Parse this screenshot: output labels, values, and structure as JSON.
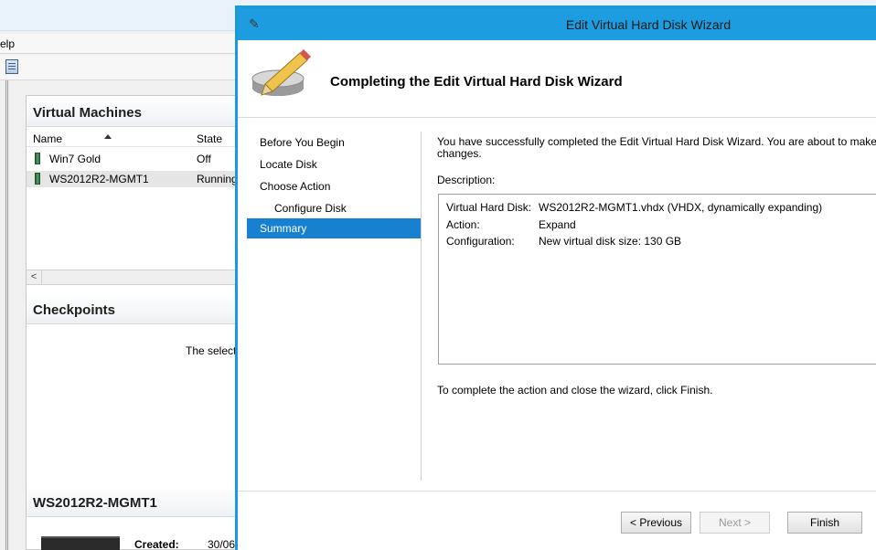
{
  "background_app": {
    "menu_fragment": "elp",
    "vm_pane": {
      "title": "Virtual Machines",
      "columns": [
        "Name",
        "State"
      ],
      "rows": [
        {
          "name": "Win7 Gold",
          "state": "Off"
        },
        {
          "name": "WS2012R2-MGMT1",
          "state": "Running"
        }
      ]
    },
    "checkpoints_pane": {
      "title": "Checkpoints",
      "message_fragment": "The selecte"
    },
    "details_pane": {
      "title": "WS2012R2-MGMT1",
      "created_label": "Created:",
      "created_value": "30/06/"
    }
  },
  "wizard": {
    "window_title": "Edit Virtual Hard Disk Wizard",
    "header_title": "Completing the Edit Virtual Hard Disk Wizard",
    "nav": [
      {
        "label": "Before You Begin"
      },
      {
        "label": "Locate Disk"
      },
      {
        "label": "Choose Action"
      },
      {
        "label": "Configure Disk"
      },
      {
        "label": "Summary"
      }
    ],
    "selected_nav": "Summary",
    "intro_line1": "You have successfully completed the Edit Virtual Hard Disk Wizard. You are about to make",
    "intro_line2": "changes.",
    "description_label": "Description:",
    "summary": [
      {
        "key": "Virtual Hard Disk:",
        "value": "WS2012R2-MGMT1.vhdx (VHDX, dynamically expanding)"
      },
      {
        "key": "Action:",
        "value": "Expand"
      },
      {
        "key": "Configuration:",
        "value": "New virtual disk size: 130 GB"
      }
    ],
    "finish_hint": "To complete the action and close the wizard, click Finish.",
    "buttons": {
      "previous": "< Previous",
      "next": "Next >",
      "finish": "Finish"
    }
  },
  "colors": {
    "wizard_accent": "#1d9de0",
    "nav_selected": "#1780cf"
  }
}
